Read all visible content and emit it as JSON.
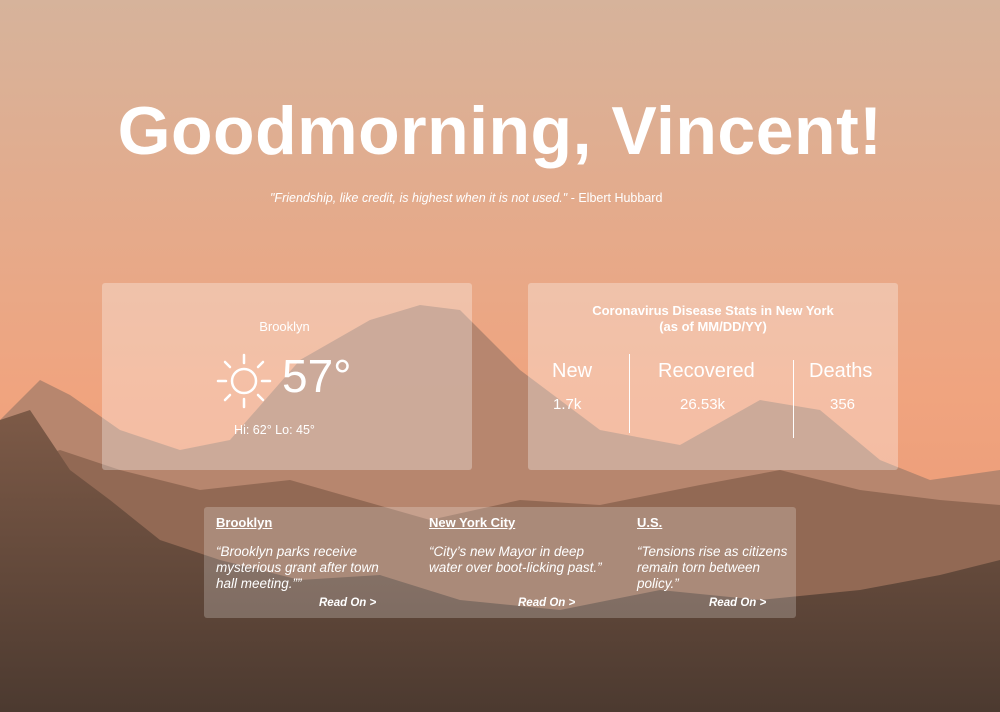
{
  "greeting": "Goodmorning, Vincent!",
  "quote": {
    "text": "\"Friendship, like credit, is highest when it is not used.\"",
    "author": " - Elbert Hubbard"
  },
  "weather": {
    "city": "Brooklyn",
    "icon": "sun-icon",
    "temperature": "57°",
    "hilo": "Hi: 62° Lo: 45°"
  },
  "covid": {
    "title_line1": "Coronavirus Disease Stats in New York",
    "title_line2": "(as of MM/DD/YY)",
    "stats": [
      {
        "label": "New",
        "value": "1.7k"
      },
      {
        "label": "Recovered",
        "value": "26.53k"
      },
      {
        "label": "Deaths",
        "value": "356"
      }
    ]
  },
  "news": [
    {
      "heading": "Brooklyn",
      "body": "“Brooklyn parks receive mysterious grant after town hall meeting.””",
      "link": "Read On >"
    },
    {
      "heading": "New York City",
      "body": "“City’s new Mayor in deep water over boot-licking past.”",
      "link": "Read On >"
    },
    {
      "heading": "U.S.",
      "body": "“Tensions rise as citizens remain torn between policy.”",
      "link": "Read On >"
    }
  ],
  "colors": {
    "sky_top": "#d6b39b",
    "sky_bottom": "#f0a27c",
    "mountain_far": "#b0836d",
    "mountain_mid": "#8c6450",
    "mountain_near": "#5f4637"
  }
}
